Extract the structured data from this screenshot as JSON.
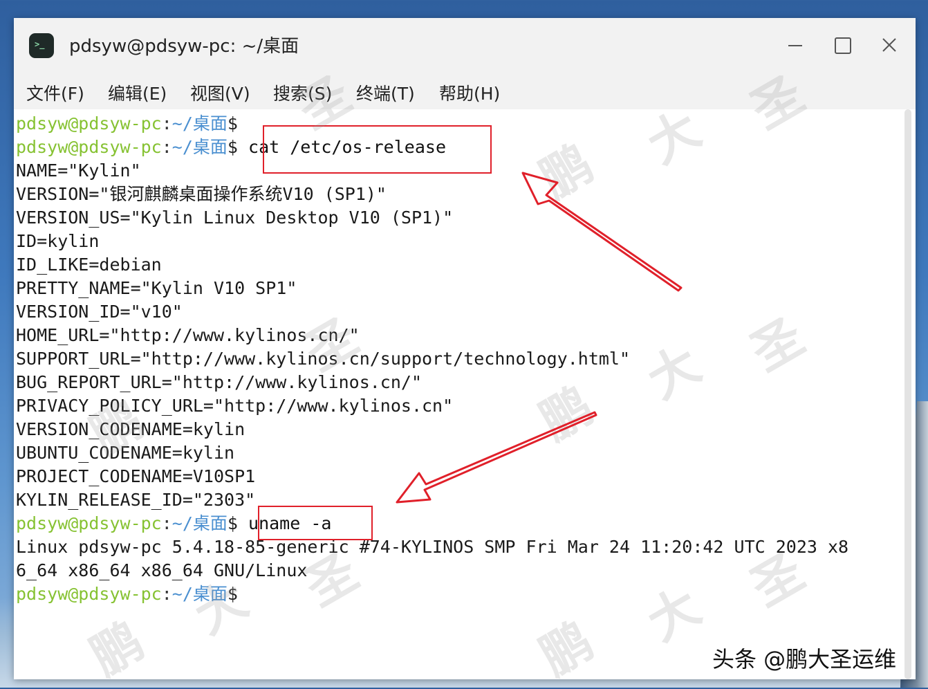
{
  "window": {
    "title": "pdsyw@pdsyw-pc: ~/桌面",
    "icon": "terminal-icon"
  },
  "menu": [
    {
      "label": "文件(F)"
    },
    {
      "label": "编辑(E)"
    },
    {
      "label": "视图(V)"
    },
    {
      "label": "搜索(S)"
    },
    {
      "label": "终端(T)"
    },
    {
      "label": "帮助(H)"
    }
  ],
  "prompt": {
    "user": "pdsyw@pdsyw-pc",
    "sep": ":",
    "dir": "~/桌面",
    "sign": "$"
  },
  "terminal": {
    "cmd1": "cat /etc/os-release",
    "output1": [
      "NAME=\"Kylin\"",
      "VERSION=\"银河麒麟桌面操作系统V10 (SP1)\"",
      "VERSION_US=\"Kylin Linux Desktop V10 (SP1)\"",
      "ID=kylin",
      "ID_LIKE=debian",
      "PRETTY_NAME=\"Kylin V10 SP1\"",
      "VERSION_ID=\"v10\"",
      "HOME_URL=\"http://www.kylinos.cn/\"",
      "SUPPORT_URL=\"http://www.kylinos.cn/support/technology.html\"",
      "BUG_REPORT_URL=\"http://www.kylinos.cn/\"",
      "PRIVACY_POLICY_URL=\"http://www.kylinos.cn\"",
      "VERSION_CODENAME=kylin",
      "UBUNTU_CODENAME=kylin",
      "PROJECT_CODENAME=V10SP1",
      "KYLIN_RELEASE_ID=\"2303\""
    ],
    "cmd2": "uname -a",
    "output2": [
      "Linux pdsyw-pc 5.4.18-85-generic #74-KYLINOS SMP Fri Mar 24 11:20:42 UTC 2023 x8",
      "6_64 x86_64 x86_64 GNU/Linux"
    ]
  },
  "watermark": {
    "chars": [
      "鹏",
      "大",
      "圣"
    ]
  },
  "credit": "头条 @鹏大圣运维",
  "colors": {
    "prompt_user": "#86c232",
    "prompt_dir": "#4a8fd0",
    "highlight": "#e0202a"
  }
}
